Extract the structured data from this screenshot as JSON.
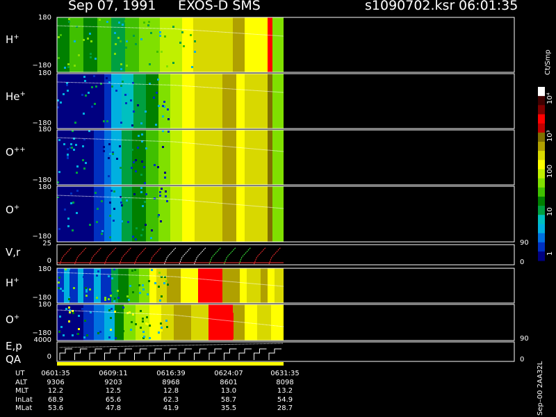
{
  "header": {
    "date": "Sep 07, 1991",
    "instrument": "EXOS-D SMS",
    "file": "s1090702.ksr",
    "time": "06:01:35"
  },
  "panels": [
    {
      "species": "H",
      "charge": "+",
      "top": "180",
      "bottom": "−180"
    },
    {
      "species": "He",
      "charge": "+",
      "top": "180",
      "bottom": "−180"
    },
    {
      "species": "O",
      "charge": "++",
      "top": "180",
      "bottom": "−180"
    },
    {
      "species": "O",
      "charge": "+",
      "top": "180",
      "bottom": "−180"
    },
    {
      "label": "V,r",
      "top": "25",
      "bottom": "0",
      "right_top": "90",
      "right_bottom": "0"
    },
    {
      "species": "H",
      "charge": "+",
      "top": "180",
      "bottom": "−180"
    },
    {
      "species": "O",
      "charge": "+",
      "top": "180",
      "bottom": "−180"
    },
    {
      "label": "E,p",
      "label2": "QA",
      "top": "4000",
      "bottom": "0",
      "right_top": "90",
      "right_bottom": "0"
    }
  ],
  "colorbar": {
    "unit": "Ct/Smp",
    "ticks": [
      "10⁴",
      "10³",
      "100",
      "10",
      "1"
    ],
    "footer": "Sep–00  2AA32L"
  },
  "ephemeris": {
    "row_labels": [
      "UT",
      "ALT",
      "MLT",
      "InLat",
      "MLat"
    ],
    "columns": [
      [
        "0601:35",
        "9306",
        "12.2",
        "68.9",
        "53.6"
      ],
      [
        "0609:11",
        "9203",
        "12.5",
        "65.6",
        "47.8"
      ],
      [
        "0616:39",
        "8968",
        "12.8",
        "62.3",
        "41.9"
      ],
      [
        "0624:07",
        "8601",
        "13.0",
        "58.7",
        "35.5"
      ],
      [
        "0631:35",
        "8098",
        "13.2",
        "54.9",
        "28.7"
      ]
    ]
  },
  "colors": {
    "scale": [
      "#000080",
      "#0030c0",
      "#0070e0",
      "#00b0e0",
      "#00c0c0",
      "#00a040",
      "#008000",
      "#40c000",
      "#80e000",
      "#c0f000",
      "#ffff00",
      "#d8d800",
      "#b0a000",
      "#807000",
      "#c00000",
      "#ff0000",
      "#800000",
      "#400000",
      "#ffffff"
    ]
  },
  "chart_data": {
    "type": "heatmap",
    "title": "Sep 07, 1991   EXOS-D SMS",
    "x": [
      "0601:35",
      "0609:11",
      "0616:39",
      "0624:07",
      "0631:35"
    ],
    "xlabel": "UT",
    "panels": [
      {
        "label": "H+",
        "ylim": [
          -180,
          180
        ]
      },
      {
        "label": "He+",
        "ylim": [
          -180,
          180
        ]
      },
      {
        "label": "O++",
        "ylim": [
          -180,
          180
        ]
      },
      {
        "label": "O+",
        "ylim": [
          -180,
          180
        ]
      },
      {
        "label": "V,r",
        "ylim": [
          0,
          25
        ],
        "ylim_right": [
          0,
          90
        ]
      },
      {
        "label": "H+",
        "ylim": [
          -180,
          180
        ]
      },
      {
        "label": "O+",
        "ylim": [
          -180,
          180
        ]
      },
      {
        "label": "E,p QA",
        "ylim": [
          0,
          4000
        ],
        "ylim_right": [
          0,
          90
        ]
      }
    ],
    "colorbar": {
      "label": "Ct/Smp",
      "scale": "log",
      "range": [
        1,
        10000
      ]
    }
  }
}
